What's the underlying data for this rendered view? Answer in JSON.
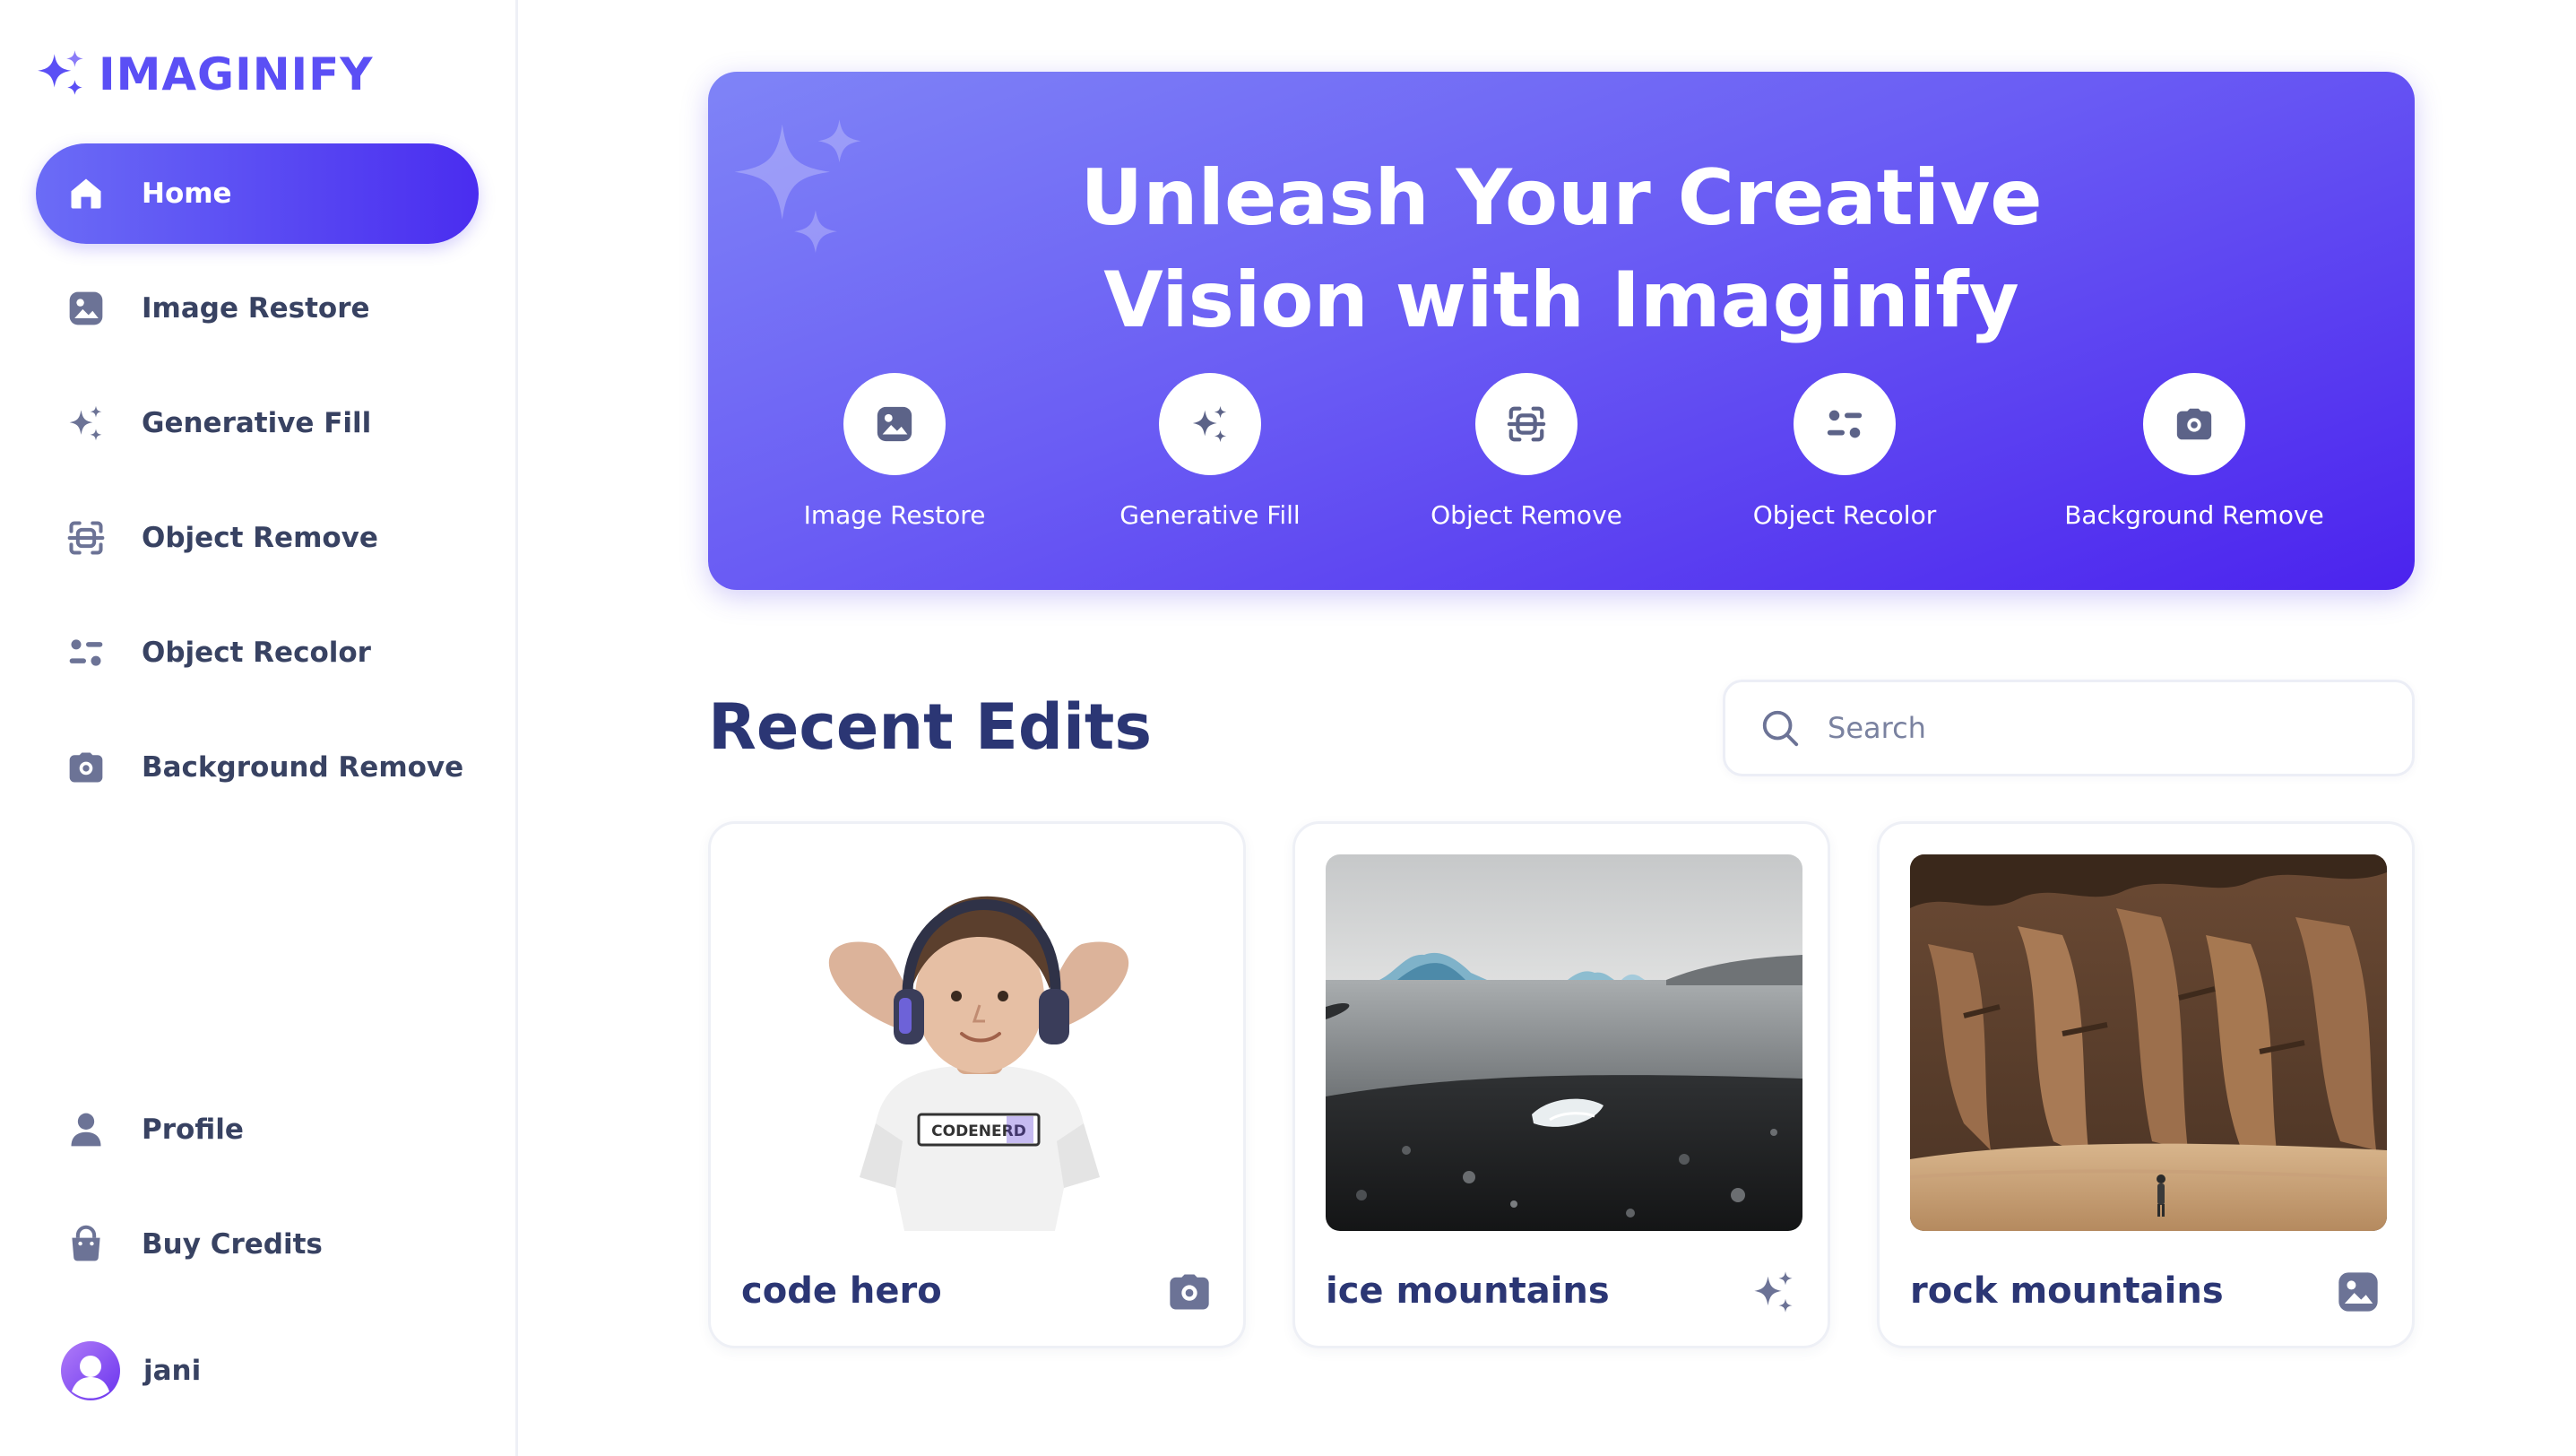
{
  "app": {
    "logo_text": "IMAGINIFY",
    "accent_color": "#5b4ff5",
    "text_color": "#2b3674"
  },
  "sidebar": {
    "items": [
      {
        "label": "Home",
        "icon": "home-icon",
        "active": true
      },
      {
        "label": "Image Restore",
        "icon": "image-icon"
      },
      {
        "label": "Generative Fill",
        "icon": "stars-icon"
      },
      {
        "label": "Object Remove",
        "icon": "scan-icon"
      },
      {
        "label": "Object Recolor",
        "icon": "filter-icon"
      },
      {
        "label": "Background Remove",
        "icon": "camera-icon"
      }
    ],
    "bottom_items": [
      {
        "label": "Profile",
        "icon": "profile-icon"
      },
      {
        "label": "Buy Credits",
        "icon": "bag-icon"
      }
    ],
    "user": {
      "name": "jani"
    }
  },
  "hero": {
    "title_line1": "Unleash Your Creative",
    "title_line2": "Vision with Imaginify",
    "tools": [
      {
        "label": "Image Restore",
        "icon": "image-icon"
      },
      {
        "label": "Generative Fill",
        "icon": "stars-icon"
      },
      {
        "label": "Object Remove",
        "icon": "scan-icon"
      },
      {
        "label": "Object Recolor",
        "icon": "filter-icon"
      },
      {
        "label": "Background Remove",
        "icon": "camera-icon"
      }
    ]
  },
  "recent": {
    "title": "Recent Edits",
    "search_placeholder": "Search",
    "cards": [
      {
        "title": "code hero",
        "icon": "camera-icon"
      },
      {
        "title": "ice mountains",
        "icon": "stars-icon"
      },
      {
        "title": "rock mountains",
        "icon": "image-icon"
      }
    ],
    "shirt_text": "CODENERD"
  }
}
